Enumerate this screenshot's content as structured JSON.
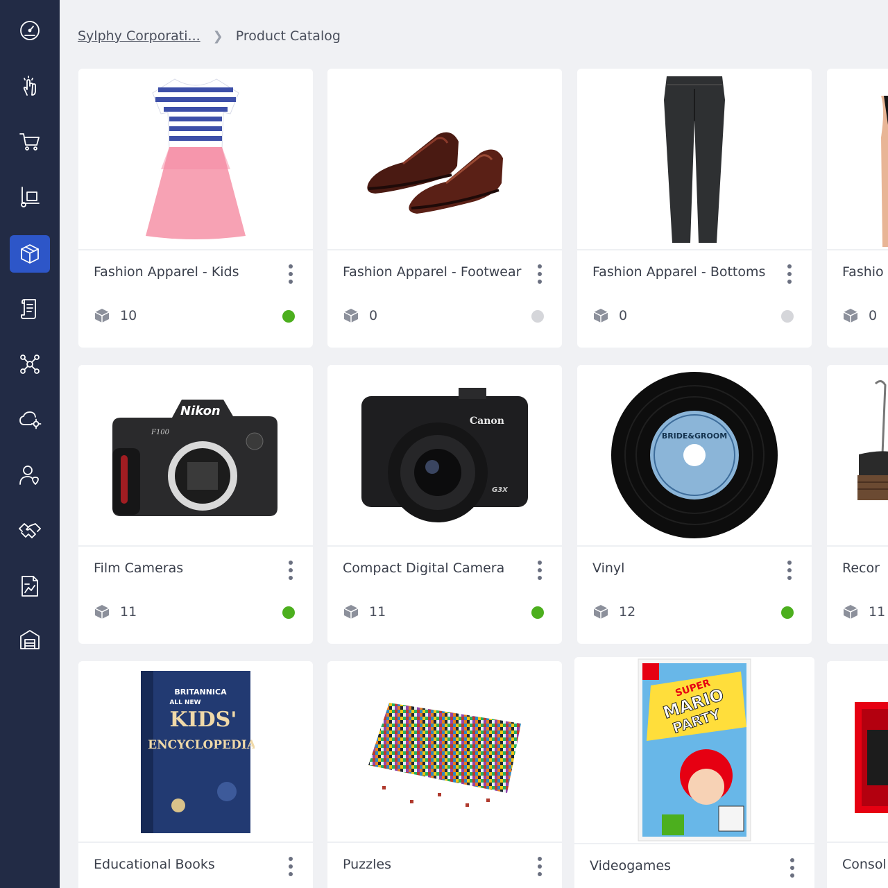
{
  "colors": {
    "sidebar": "#222b45",
    "nav_active": "#2d56c8",
    "status_active": "#4caf1e",
    "status_inactive": "#d5d6da",
    "page_bg": "#f0f1f4"
  },
  "sidebar": {
    "items": [
      {
        "icon": "dashboard-gauge-icon",
        "active": false
      },
      {
        "icon": "touch-hand-icon",
        "active": false
      },
      {
        "icon": "shopping-cart-icon",
        "active": false
      },
      {
        "icon": "hand-truck-icon",
        "active": false
      },
      {
        "icon": "package-cube-icon",
        "active": true
      },
      {
        "icon": "scroll-document-icon",
        "active": false
      },
      {
        "icon": "network-nodes-icon",
        "active": false
      },
      {
        "icon": "cloud-settings-icon",
        "active": false
      },
      {
        "icon": "user-location-icon",
        "active": false
      },
      {
        "icon": "handshake-icon",
        "active": false
      },
      {
        "icon": "report-chart-icon",
        "active": false
      },
      {
        "icon": "warehouse-icon",
        "active": false
      }
    ]
  },
  "breadcrumb": {
    "parent": "Sylphy Corporati...",
    "current": "Product Catalog"
  },
  "cards": [
    {
      "title": "Fashion Apparel - Kids",
      "count": "10",
      "status": "active",
      "image": "striped-kids-dress"
    },
    {
      "title": "Fashion Apparel - Footwear",
      "count": "0",
      "status": "inactive",
      "image": "brown-leather-shoes"
    },
    {
      "title": "Fashion Apparel - Bottoms",
      "count": "0",
      "status": "inactive",
      "image": "dark-trousers"
    },
    {
      "title": "Fashio",
      "count": "0",
      "status": "inactive",
      "image": "tshirt-partial"
    },
    {
      "title": "Film Cameras",
      "count": "11",
      "status": "active",
      "image": "nikon-f100-body"
    },
    {
      "title": "Compact Digital Camera",
      "count": "11",
      "status": "active",
      "image": "canon-g3x-camera"
    },
    {
      "title": "Vinyl",
      "count": "12",
      "status": "active",
      "image": "vinyl-record"
    },
    {
      "title": "Recor",
      "count": "11",
      "status": "none",
      "image": "record-player-partial"
    },
    {
      "title": "Educational Books",
      "count": "",
      "status": "none",
      "image": "kids-encyclopedia-book"
    },
    {
      "title": "Puzzles",
      "count": "",
      "status": "none",
      "image": "jigsaw-puzzle"
    },
    {
      "title": "Videogames",
      "count": "",
      "status": "none",
      "image": "mario-party-box"
    },
    {
      "title": "Consol",
      "count": "",
      "status": "none",
      "image": "console-box-partial"
    }
  ],
  "image_texts": {
    "nikon_brand": "Nikon",
    "nikon_model": "F100",
    "canon_brand": "Canon",
    "canon_model": "G3X",
    "vinyl_label": "BRIDE&GROOM",
    "book_brand": "BRITANNICA",
    "book_line2": "ALL NEW",
    "book_line3": "KIDS'",
    "book_line4": "ENCYCLOPEDIA",
    "game_line1": "SUPER",
    "game_line2": "MARIO",
    "game_line3": "PARTY"
  }
}
